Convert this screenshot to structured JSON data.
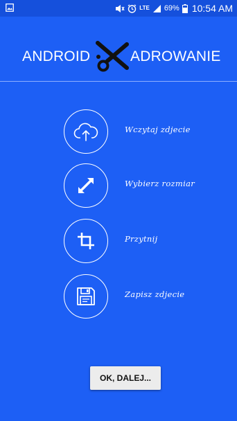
{
  "status_bar": {
    "signal_type": "LTE",
    "battery_percent": "69%",
    "time": "10:54 AM"
  },
  "header": {
    "logo_left": "ANDROID",
    "logo_right": "ADROWANIE",
    "logo_icon": "scissors-icon"
  },
  "menu": [
    {
      "label": "Wczytaj zdjecie",
      "icon": "upload-cloud-icon"
    },
    {
      "label": "Wybierz rozmiar",
      "icon": "resize-arrows-icon"
    },
    {
      "label": "Przytnij",
      "icon": "crop-icon"
    },
    {
      "label": "Zapisz zdjecie",
      "icon": "save-floppy-icon"
    }
  ],
  "ok_button": {
    "label": "OK, DALEJ..."
  },
  "colors": {
    "background": "#1d5ff5",
    "status_bar": "#1550dc",
    "button": "#ececec"
  }
}
